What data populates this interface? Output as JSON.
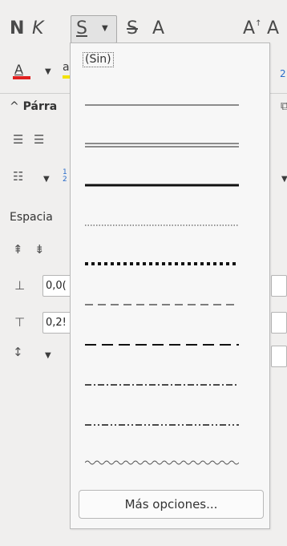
{
  "toolbar": {
    "bold_label": "N",
    "italic_label": "K",
    "underline_label": "S",
    "strike_label": "S",
    "shadow_label": "A",
    "grow_label": "A",
    "shrink_label": "A",
    "font_color_label": "A",
    "highlight_label": "a",
    "font_color": "#e02020",
    "highlight_color": "#f3e300"
  },
  "panel": {
    "section_title": "Párra",
    "spacing_label": "Espacia",
    "above_value": "0,0(",
    "below_value": "0,2!",
    "right_digit": "2"
  },
  "underline_menu": {
    "none_label": "(Sin)",
    "styles": [
      "single",
      "double",
      "bold",
      "dotted",
      "bold-dotted",
      "dash",
      "long-dash",
      "dash-dot",
      "dash-dot-dot",
      "wave"
    ],
    "more_button": "Más opciones..."
  }
}
